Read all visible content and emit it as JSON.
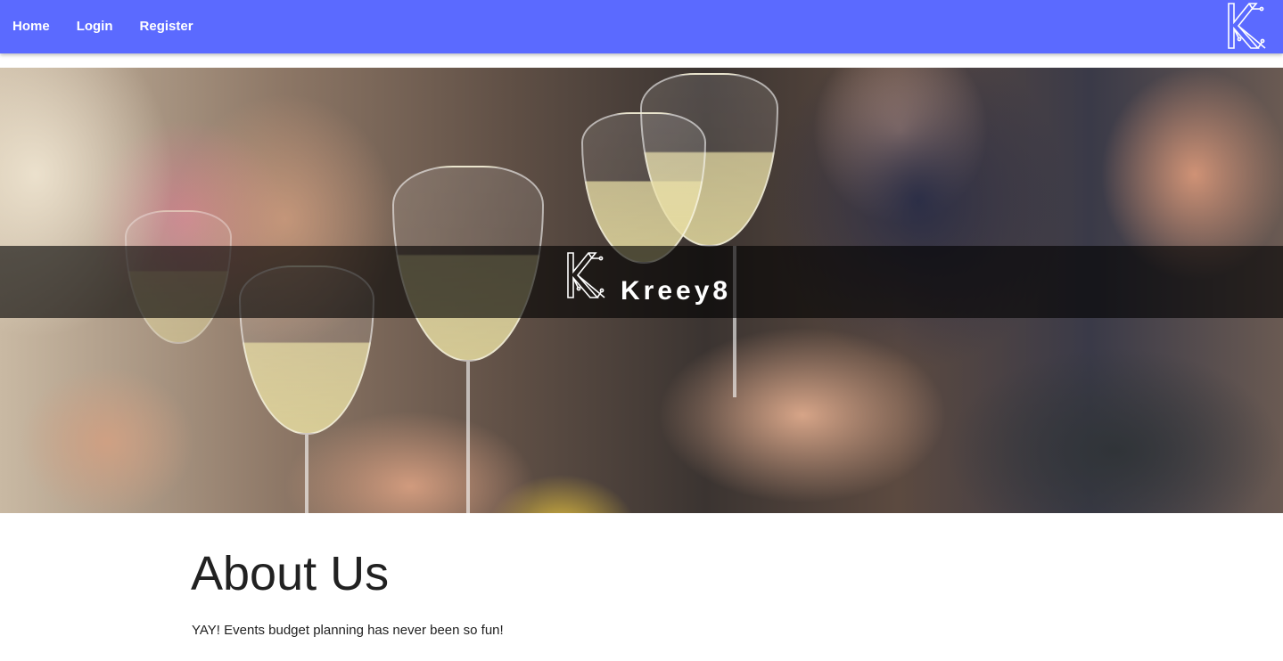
{
  "nav": {
    "items": [
      {
        "label": "Home"
      },
      {
        "label": "Login"
      },
      {
        "label": "Register"
      }
    ],
    "logo_icon": "kreey8-logo-icon"
  },
  "hero": {
    "brand_title": "Kreey8",
    "logo_icon": "kreey8-logo-icon",
    "image_description_icon": "hero-photo"
  },
  "about": {
    "heading": "About Us",
    "text": "YAY! Events budget planning has never been so fun!"
  },
  "colors": {
    "navbar_bg": "#5b6aff",
    "nav_text": "#ffffff",
    "band_overlay": "rgba(0,0,0,0.62)",
    "body_text": "#212121"
  }
}
